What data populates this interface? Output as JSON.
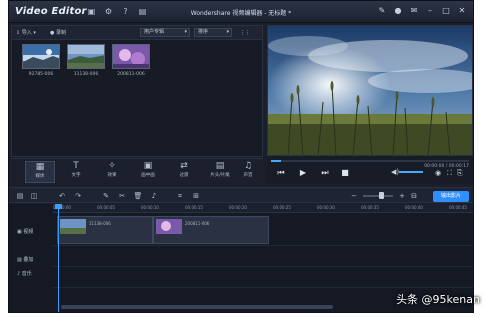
{
  "app": {
    "title": "Video Editor",
    "window_title": "Wondershare 视频编辑器 - 无标题 *"
  },
  "media": {
    "import_label": "导入",
    "record_label": "录制",
    "filter_value": "用户专辑",
    "sort_value": "排序",
    "items": [
      {
        "caption": "92785-006"
      },
      {
        "caption": "11138-006"
      },
      {
        "caption": "200811-006"
      }
    ]
  },
  "tools": [
    {
      "label": "媒体",
      "icon": "film-icon"
    },
    {
      "label": "文字",
      "icon": "text-icon"
    },
    {
      "label": "效果",
      "icon": "effects-icon"
    },
    {
      "label": "画中画",
      "icon": "pip-icon"
    },
    {
      "label": "过渡",
      "icon": "transition-icon"
    },
    {
      "label": "片头/片尾",
      "icon": "intro-icon"
    },
    {
      "label": "声音",
      "icon": "audio-icon"
    }
  ],
  "player": {
    "timecode": "00:00:00 / 00:00:17",
    "progress": 0.05,
    "volume": 0.6
  },
  "timeline_toolbar": {
    "export_label": "输出影片"
  },
  "timeline": {
    "ruler": [
      "00:00:00",
      "00:00:05",
      "00:00:10",
      "00:00:15",
      "00:00:20",
      "00:00:25",
      "00:00:30",
      "00:00:35",
      "00:00:40",
      "00:00:45"
    ],
    "tracks": [
      {
        "label": "视频"
      },
      {
        "label": "叠加"
      },
      {
        "label": "音乐"
      }
    ],
    "clips": [
      {
        "name": "11138-006"
      },
      {
        "name": "200811-006"
      }
    ]
  },
  "watermark": "头条 @95kenan",
  "colors": {
    "accent": "#2f8fff",
    "background": "#1a1f2b"
  }
}
